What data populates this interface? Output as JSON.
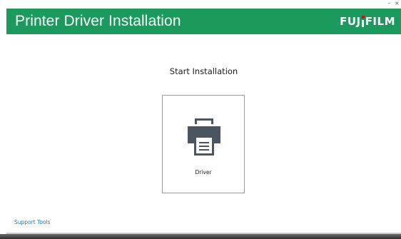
{
  "window": {
    "minimize_glyph": "–",
    "close_glyph": "×"
  },
  "header": {
    "title": "Printer Driver Installation",
    "brand_prefix": "FUJ",
    "brand_suffix": "FILM",
    "brand_letter_i": "I",
    "accent_color": "#1c9a5e",
    "brand_dot_color": "#e60012"
  },
  "main": {
    "heading": "Start Installation",
    "tiles": [
      {
        "label": "Driver",
        "icon": "printer-icon"
      }
    ]
  },
  "footer": {
    "support_link": "Support Tools"
  }
}
